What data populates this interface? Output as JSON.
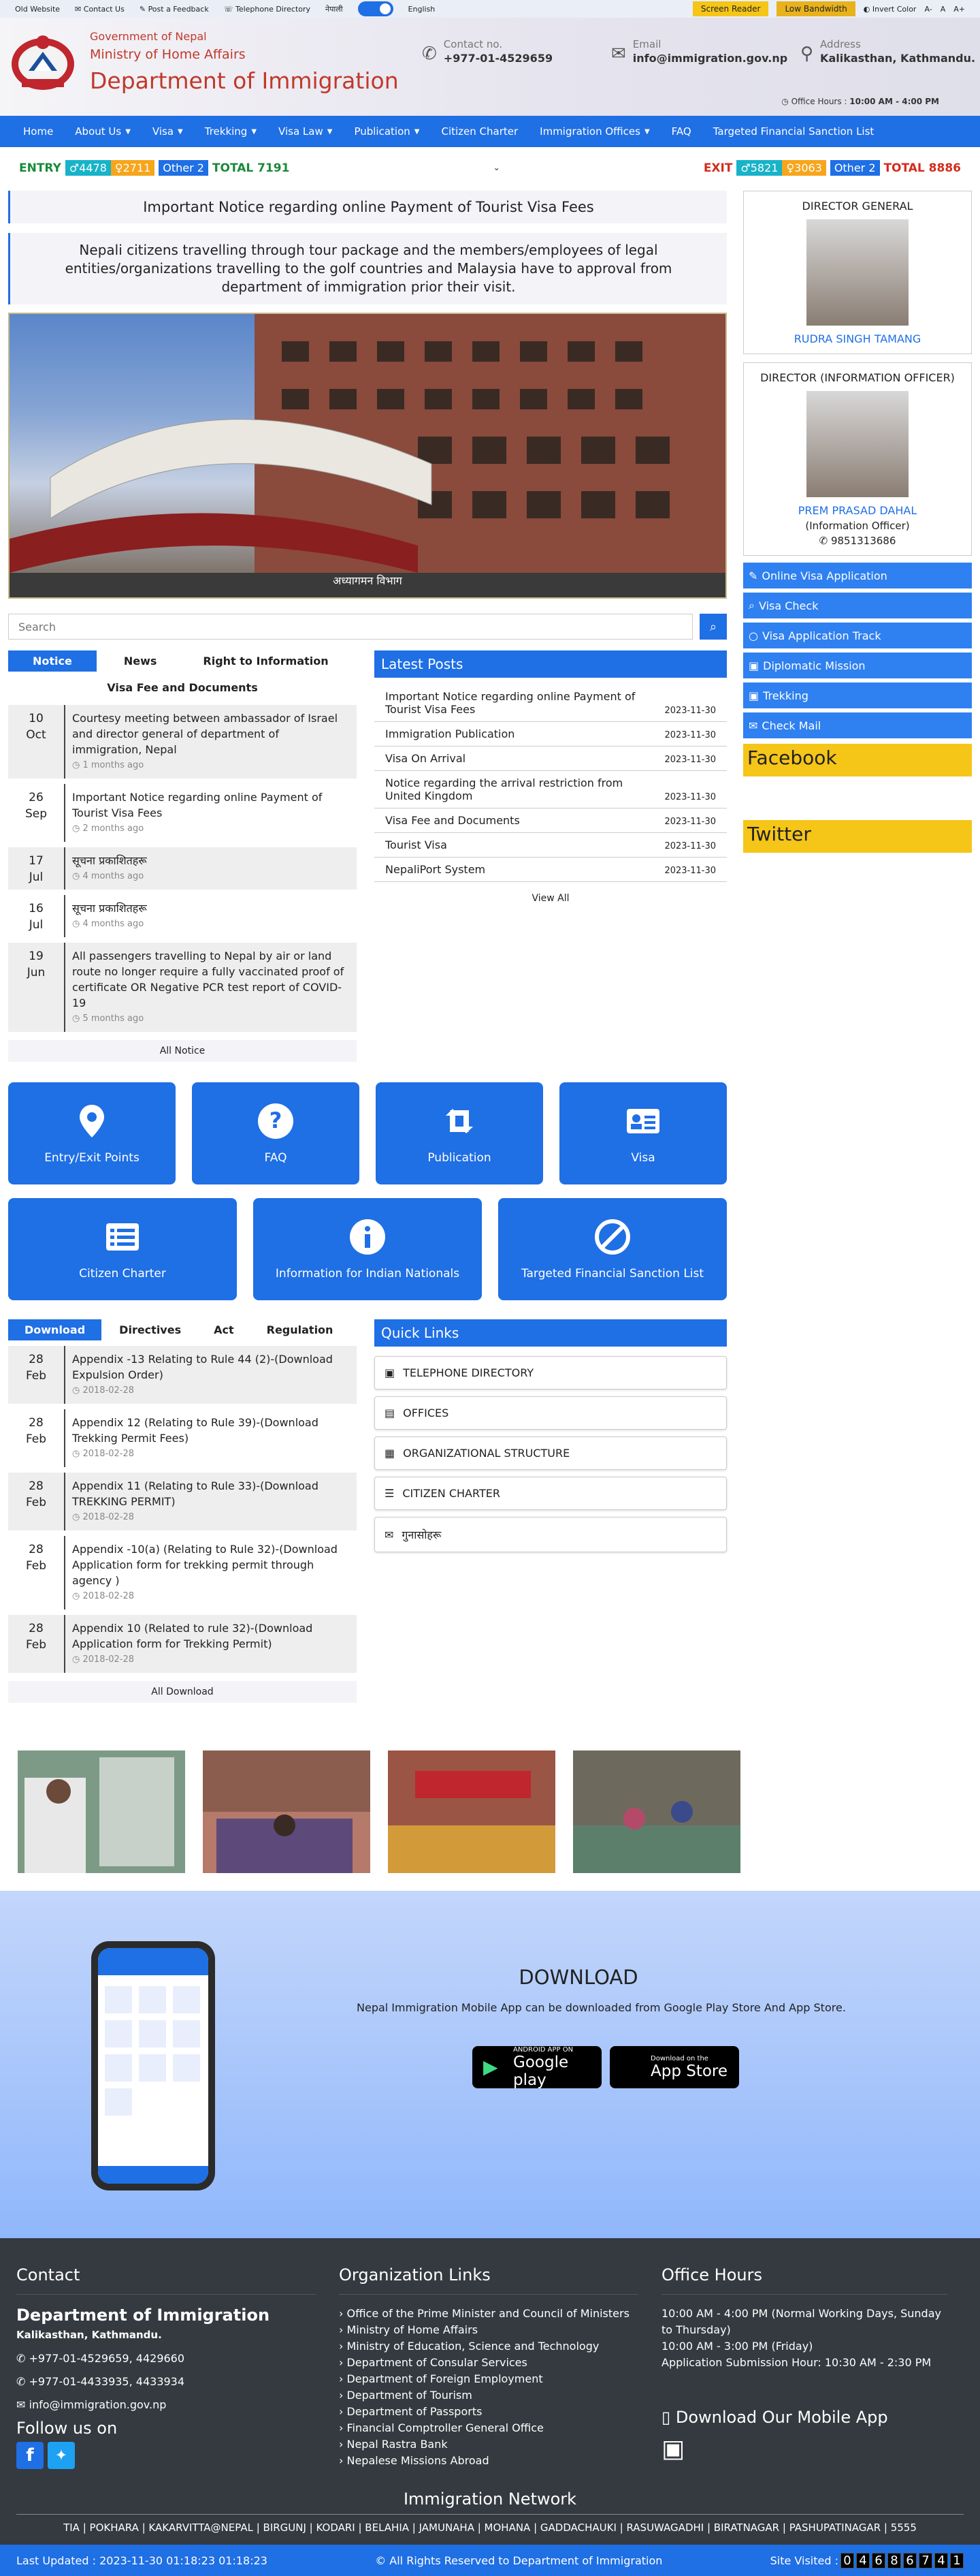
{
  "topbar": {
    "links": [
      "Old Website",
      "Contact Us",
      "Post a Feedback",
      "Telephone Directory"
    ],
    "lang_nepali": "नेपाली",
    "lang_english": "English",
    "screen_reader": "Screen Reader",
    "low_bandwidth": "Low Bandwidth",
    "invert_color": "Invert Color",
    "font_small": "A-",
    "font_normal": "A",
    "font_large": "A+"
  },
  "header": {
    "gov": "Government of Nepal",
    "ministry": "Ministry of Home Affairs",
    "dept": "Department of Immigration",
    "contact_label": "Contact no.",
    "contact_value": "+977-01-4529659",
    "email_label": "Email",
    "email_value": "info@immigration.gov.np",
    "address_label": "Address",
    "address_value": "Kalikasthan, Kathmandu.",
    "office_hours_label": "Office Hours :",
    "office_hours_value": "10:00 AM - 4:00 PM"
  },
  "nav": [
    {
      "label": "Home",
      "dropdown": false
    },
    {
      "label": "About Us",
      "dropdown": true
    },
    {
      "label": "Visa",
      "dropdown": true
    },
    {
      "label": "Trekking",
      "dropdown": true
    },
    {
      "label": "Visa Law",
      "dropdown": true
    },
    {
      "label": "Publication",
      "dropdown": true
    },
    {
      "label": "Citizen Charter",
      "dropdown": false
    },
    {
      "label": "Immigration Offices",
      "dropdown": true
    },
    {
      "label": "FAQ",
      "dropdown": false
    },
    {
      "label": "Targeted Financial Sanction List",
      "dropdown": false
    }
  ],
  "counter": {
    "entry_label": "ENTRY",
    "entry_male": "4478",
    "entry_female": "2711",
    "entry_other": "Other 2",
    "entry_total": "TOTAL 7191",
    "exit_label": "EXIT",
    "exit_male": "5821",
    "exit_female": "3063",
    "exit_other": "Other 2",
    "exit_total": "TOTAL 8886",
    "colors": {
      "entry": "#1a8a3a",
      "exit": "#d52b1e",
      "male": "#17b3c9",
      "female": "#f7a51b",
      "other": "#1f6fe5"
    }
  },
  "notice": {
    "title": "Important Notice regarding online Payment of Tourist Visa Fees",
    "text": "Nepali citizens travelling through tour package and the members/employees of legal entities/organizations travelling to the golf countries and Malaysia have to approval from department of immigration prior their visit."
  },
  "banner": {
    "caption": "अध्यागमन विभाग"
  },
  "search": {
    "placeholder": "Search"
  },
  "notice_tabs": [
    "Notice",
    "News",
    "Right to Information",
    "Visa Fee and Documents"
  ],
  "notices": [
    {
      "day": "10",
      "month": "Oct",
      "text": "Courtesy meeting between ambassador of Israel and director general of department of immigration, Nepal",
      "ago": "1 months ago"
    },
    {
      "day": "26",
      "month": "Sep",
      "text": "Important Notice regarding online Payment of Tourist Visa Fees",
      "ago": "2 months ago"
    },
    {
      "day": "17",
      "month": "Jul",
      "text": "सूचना प्रकाशितहरू",
      "ago": "4 months ago"
    },
    {
      "day": "16",
      "month": "Jul",
      "text": "सूचना प्रकाशितहरू",
      "ago": "4 months ago"
    },
    {
      "day": "19",
      "month": "Jun",
      "text": "All passengers travelling to Nepal by air or land route no longer require a fully vaccinated proof of certificate OR Negative PCR test report of COVID-19",
      "ago": "5 months ago"
    }
  ],
  "all_notice": "All Notice",
  "latest": {
    "title": "Latest Posts",
    "items": [
      {
        "text": "Important Notice regarding online Payment of Tourist Visa Fees",
        "date": "2023-11-30"
      },
      {
        "text": "Immigration Publication",
        "date": "2023-11-30"
      },
      {
        "text": "Visa On Arrival",
        "date": "2023-11-30"
      },
      {
        "text": "Notice regarding the arrival restriction from United Kingdom",
        "date": "2023-11-30"
      },
      {
        "text": "Visa Fee and Documents",
        "date": "2023-11-30"
      },
      {
        "text": "Tourist Visa",
        "date": "2023-11-30"
      },
      {
        "text": "NepaliPort System",
        "date": "2023-11-30"
      }
    ],
    "view_all": "View All"
  },
  "tiles_row1": [
    "Entry/Exit Points",
    "FAQ",
    "Publication",
    "Visa"
  ],
  "tiles_row2": [
    "Citizen Charter",
    "Information for Indian Nationals",
    "Targeted Financial Sanction List"
  ],
  "download_tabs": [
    "Download",
    "Directives",
    "Act",
    "Regulation"
  ],
  "downloads": [
    {
      "day": "28",
      "month": "Feb",
      "text": "Appendix -13 Relating to Rule 44 (2)-(Download Expulsion Order)",
      "date": "2018-02-28"
    },
    {
      "day": "28",
      "month": "Feb",
      "text": "Appendix 12 (Relating to Rule 39)-(Download Trekking Permit Fees)",
      "date": "2018-02-28"
    },
    {
      "day": "28",
      "month": "Feb",
      "text": "Appendix 11 (Relating to Rule 33)-(Download TREKKING PERMIT)",
      "date": "2018-02-28"
    },
    {
      "day": "28",
      "month": "Feb",
      "text": "Appendix -10(a) (Relating to Rule 32)-(Download Application form for trekking permit through agency )",
      "date": "2018-02-28"
    },
    {
      "day": "28",
      "month": "Feb",
      "text": "Appendix 10 (Related to rule 32)-(Download Application form for Trekking Permit)",
      "date": "2018-02-28"
    }
  ],
  "all_download": "All Download",
  "quick_links": {
    "title": "Quick Links",
    "items": [
      "TELEPHONE DIRECTORY",
      "OFFICES",
      "ORGANIZATIONAL STRUCTURE",
      "CITIZEN CHARTER",
      "गुनासोहरू"
    ]
  },
  "app_download": {
    "title": "DOWNLOAD",
    "text": "Nepal Immigration Mobile App can be downloaded from Google Play Store And App Store.",
    "google_small": "ANDROID APP ON",
    "google_big": "Google play",
    "apple_small": "Download on the",
    "apple_big": "App Store"
  },
  "sidebar": {
    "dg_title": "DIRECTOR GENERAL",
    "dg_name": "RUDRA SINGH TAMANG",
    "do_title": "DIRECTOR (INFORMATION OFFICER)",
    "do_name": "PREM PRASAD DAHAL",
    "do_role": "(Information Officer)",
    "do_phone": "9851313686",
    "links": [
      "Online Visa Application",
      "Visa Check",
      "Visa Application Track",
      "Diplomatic Mission",
      "Trekking",
      "Check Mail"
    ],
    "facebook": "Facebook",
    "twitter": "Twitter"
  },
  "footer": {
    "contact_h": "Contact",
    "dept": "Department of Immigration",
    "address": "Kalikasthan, Kathmandu.",
    "phone1": "+977-01-4529659, 4429660",
    "phone2": "+977-01-4433935, 4433934",
    "email": "info@immigration.gov.np",
    "follow": "Follow us on",
    "org_h": "Organization Links",
    "org_links": [
      "Office of the Prime Minister and Council of Ministers",
      "Ministry of Home Affairs",
      "Ministry of Education, Science and Technology",
      "Department of Consular Services",
      "Department of Foreign Employment",
      "Department of Tourism",
      "Department of Passports",
      "Financial Comptroller General Office",
      "Nepal Rastra Bank",
      "Nepalese Missions Abroad"
    ],
    "hours_h": "Office Hours",
    "hours": [
      "10:00 AM - 4:00 PM (Normal Working Days, Sunday to Thursday)",
      "10:00 AM - 3:00 PM (Friday)",
      "Application Submission Hour: 10:30 AM - 2:30 PM"
    ],
    "mobile_h": "Download Our Mobile App",
    "network_h": "Immigration Network",
    "network": "TIA | POKHARA | KAKARVITTA@NEPAL | BIRGUNJ | KODARI | BELAHIA | JAMUNAHA | MOHANA | GADDACHAUKI | RASUWAGADHI | BIRATNAGAR | PASHUPATINAGAR | 5555",
    "last_updated": "Last Updated : 2023-11-30 01:18:23 01:18:23",
    "rights": "© All Rights Reserved to Department of Immigration",
    "visited_label": "Site Visited :",
    "visited_digits": [
      "0",
      "4",
      "6",
      "8",
      "6",
      "7",
      "4",
      "1"
    ]
  }
}
